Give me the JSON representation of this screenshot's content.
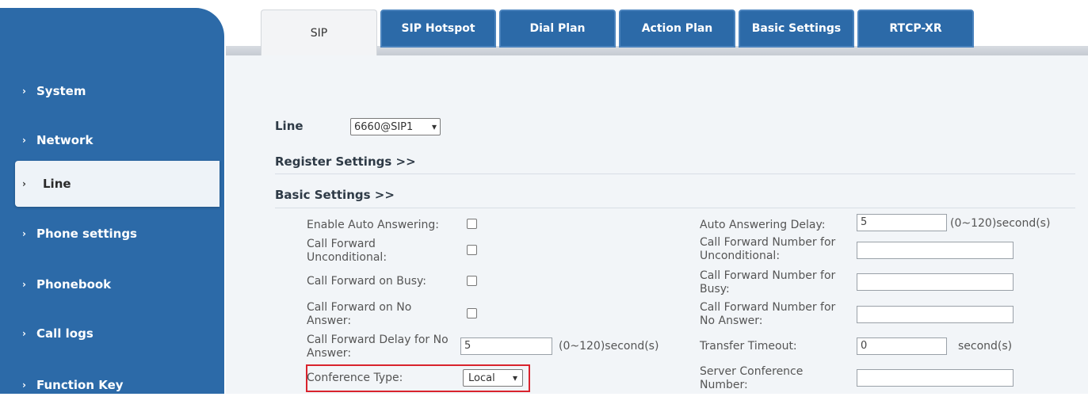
{
  "sidebar": {
    "items": [
      {
        "label": "System"
      },
      {
        "label": "Network"
      },
      {
        "label": "Line"
      },
      {
        "label": "Phone settings"
      },
      {
        "label": "Phonebook"
      },
      {
        "label": "Call logs"
      },
      {
        "label": "Function Key"
      }
    ],
    "active": "Line"
  },
  "tabs": [
    {
      "label": "SIP"
    },
    {
      "label": "SIP Hotspot"
    },
    {
      "label": "Dial Plan"
    },
    {
      "label": "Action Plan"
    },
    {
      "label": "Basic Settings"
    },
    {
      "label": "RTCP-XR"
    }
  ],
  "line": {
    "label": "Line",
    "selected": "6660@SIP1"
  },
  "sections": {
    "register": "Register Settings >>",
    "basic": "Basic Settings >>"
  },
  "left": {
    "enable_auto_answering": "Enable Auto Answering:",
    "cf_unconditional_1": "Call Forward",
    "cf_unconditional_2": "Unconditional:",
    "cf_busy": "Call Forward on Busy:",
    "cf_no_answer_1": "Call Forward on No",
    "cf_no_answer_2": "Answer:",
    "cf_delay_1": "Call Forward Delay for No",
    "cf_delay_2": "Answer:",
    "cf_delay_value": "5",
    "cf_delay_unit": "(0~120)second(s)",
    "conference_type": "Conference Type:",
    "conference_value": "Local"
  },
  "right": {
    "auto_answer_delay": "Auto Answering Delay:",
    "auto_answer_delay_value": "5",
    "auto_answer_delay_unit": "(0~120)second(s)",
    "cfn_unconditional_1": "Call Forward Number for",
    "cfn_unconditional_2": "Unconditional:",
    "cfn_busy_1": "Call Forward Number for",
    "cfn_busy_2": "Busy:",
    "cfn_no_answer_1": "Call Forward Number for",
    "cfn_no_answer_2": "No Answer:",
    "transfer_timeout": "Transfer Timeout:",
    "transfer_timeout_value": "0",
    "transfer_timeout_unit": "second(s)",
    "server_conf_1": "Server Conference",
    "server_conf_2": "Number:"
  },
  "icons": {
    "chevron": "›",
    "dropdown": "⌄"
  },
  "colors": {
    "sidebar": "#2c6aa8",
    "highlight": "#d9232d"
  }
}
